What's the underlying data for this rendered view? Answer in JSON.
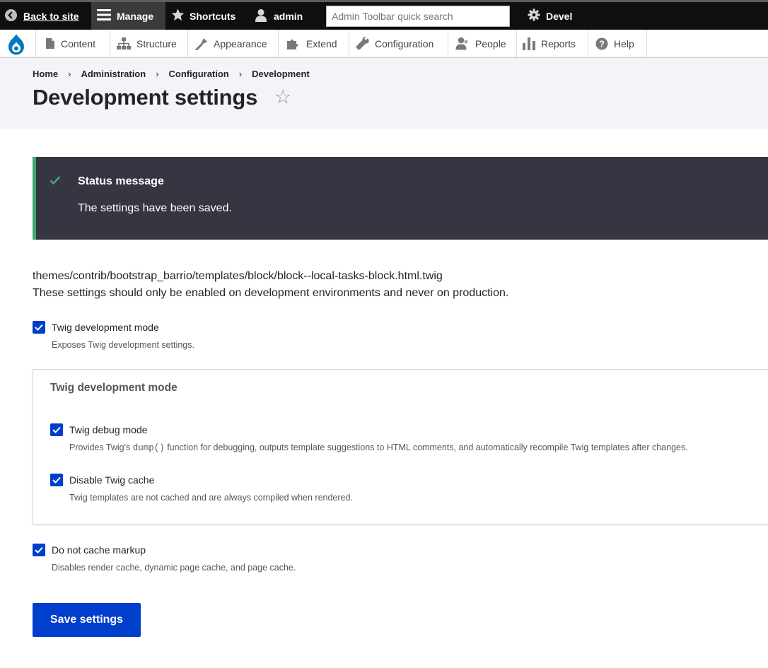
{
  "toolbar": {
    "back_label": "Back to site",
    "manage_label": "Manage",
    "shortcuts_label": "Shortcuts",
    "user_label": "admin",
    "search_placeholder": "Admin Toolbar quick search",
    "devel_label": "Devel"
  },
  "tray": {
    "items": [
      {
        "label": "Content",
        "icon": "content-icon"
      },
      {
        "label": "Structure",
        "icon": "structure-icon"
      },
      {
        "label": "Appearance",
        "icon": "appearance-icon"
      },
      {
        "label": "Extend",
        "icon": "extend-icon"
      },
      {
        "label": "Configuration",
        "icon": "configuration-icon"
      },
      {
        "label": "People",
        "icon": "people-icon"
      },
      {
        "label": "Reports",
        "icon": "reports-icon"
      },
      {
        "label": "Help",
        "icon": "help-icon"
      }
    ]
  },
  "breadcrumb": {
    "items": [
      "Home",
      "Administration",
      "Configuration",
      "Development"
    ],
    "separator": "›"
  },
  "page": {
    "title": "Development settings",
    "shortcut_star": "☆"
  },
  "status": {
    "title": "Status message",
    "text": "The settings have been saved."
  },
  "body": {
    "template_path": "themes/contrib/bootstrap_barrio/templates/block/block--local-tasks-block.html.twig",
    "warning": "These settings should only be enabled on development environments and never on production."
  },
  "form": {
    "twig_dev_mode": {
      "label": "Twig development mode",
      "description": "Exposes Twig development settings.",
      "checked": true
    },
    "fieldset_legend": "Twig development mode",
    "twig_debug": {
      "label": "Twig debug mode",
      "description_before": "Provides Twig's ",
      "description_code": "dump()",
      "description_after": " function for debugging, outputs template suggestions to HTML comments, and automatically recompile Twig templates after changes.",
      "checked": true
    },
    "twig_cache": {
      "label": "Disable Twig cache",
      "description": "Twig templates are not cached and are always compiled when rendered.",
      "checked": true
    },
    "no_cache_markup": {
      "label": "Do not cache markup",
      "description": "Disables render cache, dynamic page cache, and page cache.",
      "checked": true
    },
    "save_label": "Save settings"
  },
  "colors": {
    "primary_blue": "#003ecc",
    "toolbar_black": "#0f0f0f",
    "status_bg": "#353641",
    "status_accent": "#42a877"
  }
}
